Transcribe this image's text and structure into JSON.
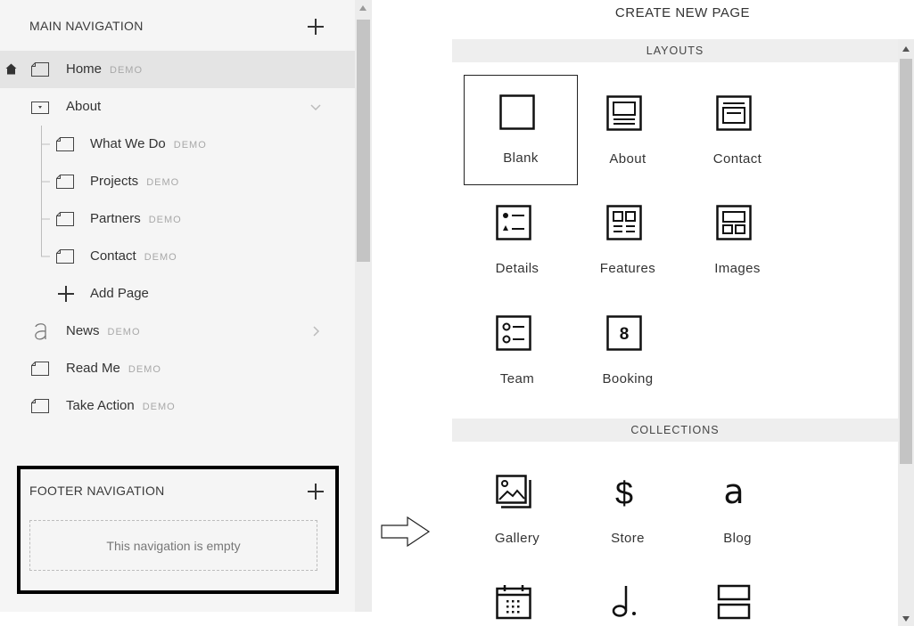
{
  "main_navigation": {
    "title": "MAIN NAVIGATION",
    "items": [
      {
        "label": "Home",
        "badge": "DEMO",
        "icon": "page-icon",
        "selected": true,
        "home": true
      },
      {
        "label": "About",
        "badge": "",
        "icon": "folder-icon",
        "expanded": true
      },
      {
        "label": "What We Do",
        "badge": "DEMO",
        "icon": "page-icon"
      },
      {
        "label": "Projects",
        "badge": "DEMO",
        "icon": "page-icon"
      },
      {
        "label": "Partners",
        "badge": "DEMO",
        "icon": "page-icon"
      },
      {
        "label": "Contact",
        "badge": "DEMO",
        "icon": "page-icon"
      },
      {
        "label": "Add Page",
        "icon": "plus-icon"
      },
      {
        "label": "News",
        "badge": "DEMO",
        "icon": "blog-icon"
      },
      {
        "label": "Read Me",
        "badge": "DEMO",
        "icon": "page-icon"
      },
      {
        "label": "Take Action",
        "badge": "DEMO",
        "icon": "page-icon"
      }
    ]
  },
  "footer_navigation": {
    "title": "FOOTER NAVIGATION",
    "empty_text": "This navigation is empty"
  },
  "create_page": {
    "title": "CREATE NEW PAGE",
    "layouts_title": "LAYOUTS",
    "layouts": [
      {
        "label": "Blank",
        "icon": "blank-layout-icon",
        "selected": true
      },
      {
        "label": "About",
        "icon": "about-layout-icon"
      },
      {
        "label": "Contact",
        "icon": "contact-layout-icon"
      },
      {
        "label": "Details",
        "icon": "details-layout-icon"
      },
      {
        "label": "Features",
        "icon": "features-layout-icon"
      },
      {
        "label": "Images",
        "icon": "images-layout-icon"
      },
      {
        "label": "Team",
        "icon": "team-layout-icon"
      },
      {
        "label": "Booking",
        "icon": "booking-layout-icon",
        "glyph": "8"
      }
    ],
    "collections_title": "COLLECTIONS",
    "collections": [
      {
        "label": "Gallery",
        "icon": "gallery-icon"
      },
      {
        "label": "Store",
        "icon": "store-dollar-icon",
        "glyph": "$"
      },
      {
        "label": "Blog",
        "icon": "blog-icon",
        "glyph": "a"
      },
      {
        "label": "",
        "icon": "calendar-icon"
      },
      {
        "label": "",
        "icon": "music-note-icon"
      },
      {
        "label": "",
        "icon": "index-icon"
      }
    ]
  },
  "colors": {
    "panel_bg": "#f5f5f5",
    "selected_row": "#e4e4e4",
    "badge_text": "#a8a8a8",
    "section_bar": "#eeeeee",
    "highlight_border": "#000000"
  }
}
